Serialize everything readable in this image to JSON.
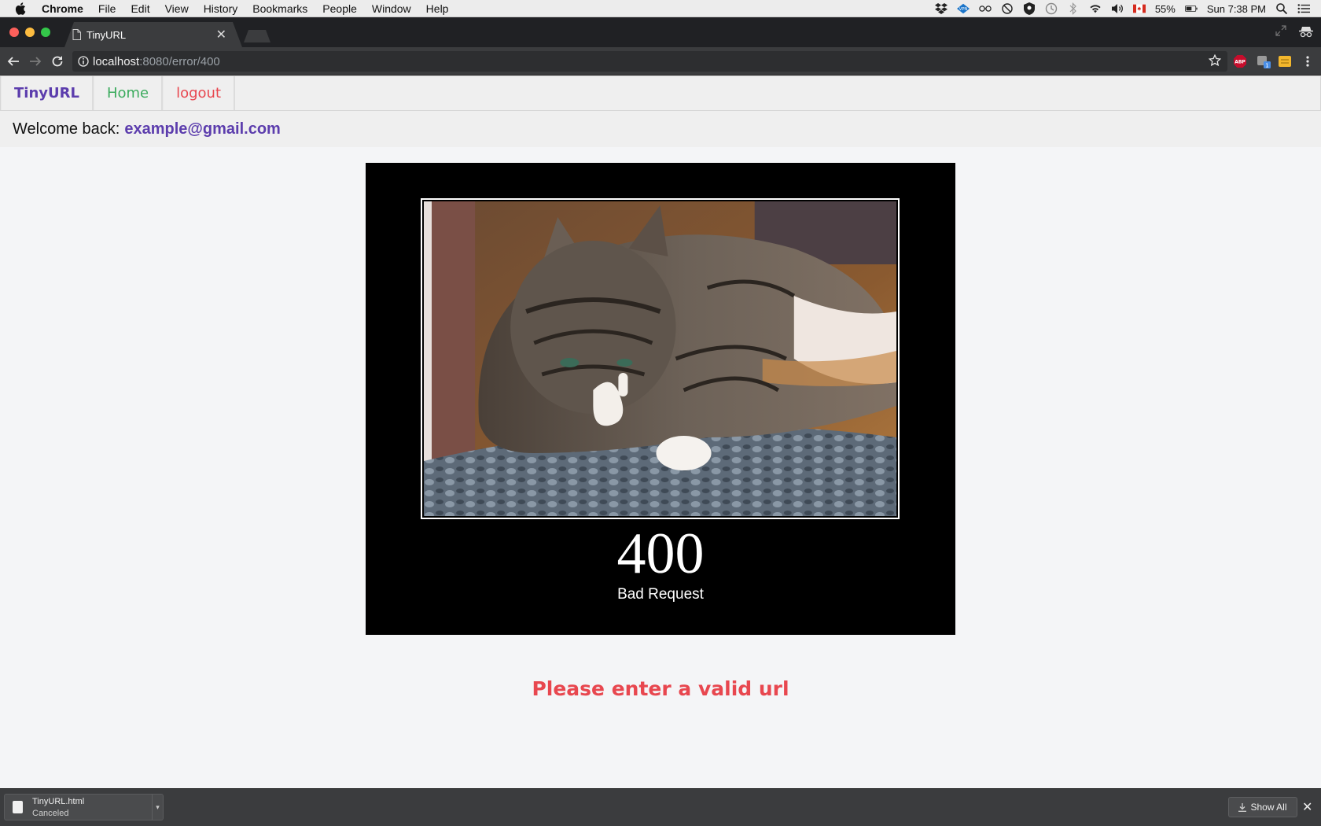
{
  "menubar": {
    "app": "Chrome",
    "items": [
      "File",
      "Edit",
      "View",
      "History",
      "Bookmarks",
      "People",
      "Window",
      "Help"
    ],
    "battery": "55%",
    "clock": "Sun 7:38 PM"
  },
  "browser": {
    "tab_title": "TinyURL",
    "url_host": "localhost",
    "url_rest": ":8080/error/400"
  },
  "nav": {
    "brand": "TinyURL",
    "home": "Home",
    "logout": "logout"
  },
  "welcome": {
    "label": "Welcome back:",
    "email": "example@gmail.com"
  },
  "error": {
    "code": "400",
    "title": "Bad Request",
    "message": "Please enter a valid url"
  },
  "downloads": {
    "filename": "TinyURL.html",
    "status": "Canceled",
    "show_all": "Show All"
  },
  "colors": {
    "brand": "#5c3dad",
    "home": "#3bab5d",
    "danger": "#e8474f"
  }
}
